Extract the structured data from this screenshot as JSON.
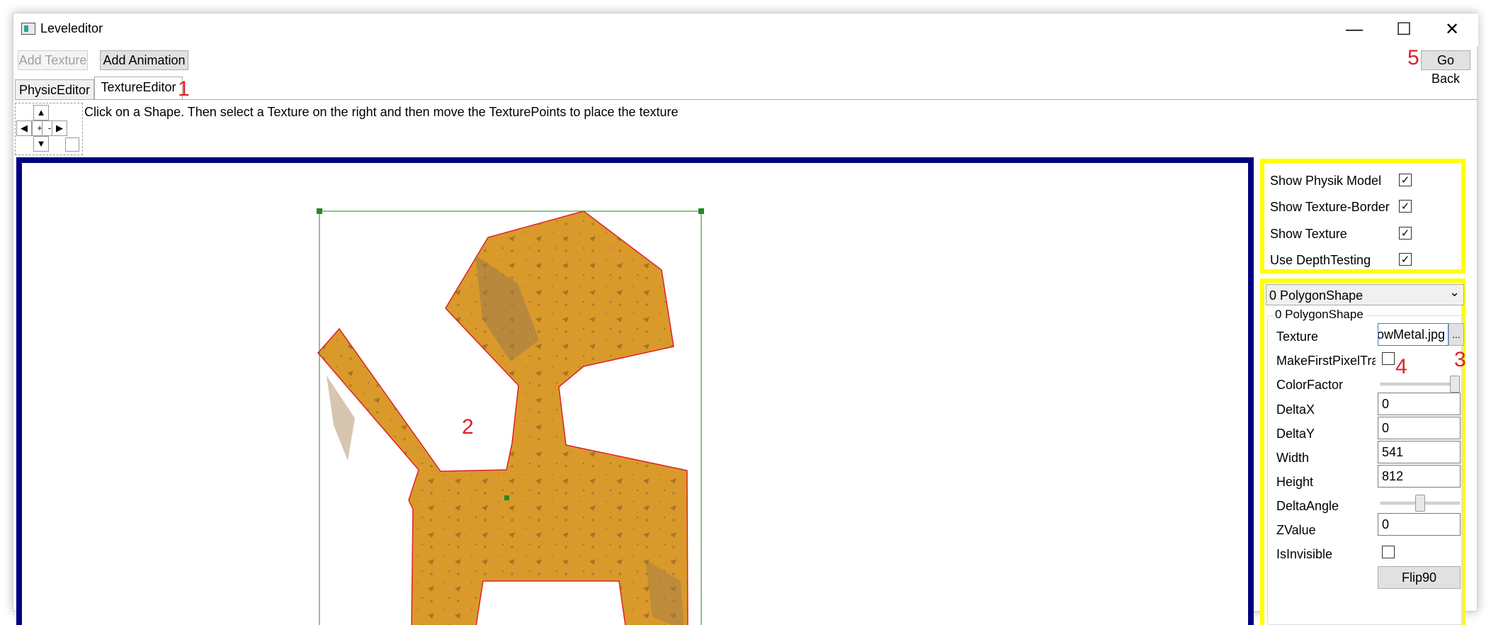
{
  "window": {
    "title": "Leveleditor",
    "minimize_icon": "minimize-icon",
    "maximize_icon": "maximize-icon",
    "close_icon": "close-icon",
    "min_glyph": "—",
    "max_glyph": "☐",
    "close_glyph": "✕"
  },
  "toolbar": {
    "add_texture_label": "Add Texture",
    "add_animation_label": "Add Animation",
    "go_back_label": "Go Back"
  },
  "tabs": [
    {
      "label": "PhysicEditor",
      "active": false
    },
    {
      "label": "TextureEditor",
      "active": true
    }
  ],
  "annotations": {
    "n1": "1",
    "n2": "2",
    "n3": "3",
    "n4": "4",
    "n5": "5"
  },
  "nav": {
    "up": "▲",
    "down": "▼",
    "left": "◀",
    "right": "▶",
    "zoom_in": "+",
    "zoom_out": "-"
  },
  "hint_text": "Click on a Shape. Then select a Texture on the right and then move the TexturePoints to place the texture",
  "view_options": [
    {
      "label": "Show Physik Model",
      "checked": true,
      "check_glyph": "✓"
    },
    {
      "label": "Show Texture-Border",
      "checked": true,
      "check_glyph": "✓"
    },
    {
      "label": "Show Texture",
      "checked": true,
      "check_glyph": "✓"
    },
    {
      "label": "Use DepthTesting",
      "checked": true,
      "check_glyph": "✓"
    }
  ],
  "shape_select": {
    "value": "0 PolygonShape",
    "arrow": "⌄"
  },
  "properties": {
    "group_title": "0 PolygonShape",
    "texture_label": "Texture",
    "texture_value": "owMetal.jpg",
    "browse_label": "...",
    "make_first_pixel_label": "MakeFirstPixelTra",
    "make_first_pixel_checked": false,
    "color_factor_label": "ColorFactor",
    "color_factor_level": 1.0,
    "delta_x_label": "DeltaX",
    "delta_x_value": "0",
    "delta_y_label": "DeltaY",
    "delta_y_value": "0",
    "width_label": "Width",
    "width_value": "541",
    "height_label": "Height",
    "height_value": "812",
    "delta_angle_label": "DeltaAngle",
    "delta_angle_level": 0.5,
    "zvalue_label": "ZValue",
    "zvalue_value": "0",
    "is_invisible_label": "IsInvisible",
    "is_invisible_checked": false,
    "flip_label": "Flip90"
  },
  "colors": {
    "canvas_border": "#000080",
    "panel_border": "#ffff00",
    "shape_fill": "#d99a2b",
    "shape_outline": "#e0202a",
    "bounding_box": "#228b22",
    "annotation": "#e0202a"
  }
}
